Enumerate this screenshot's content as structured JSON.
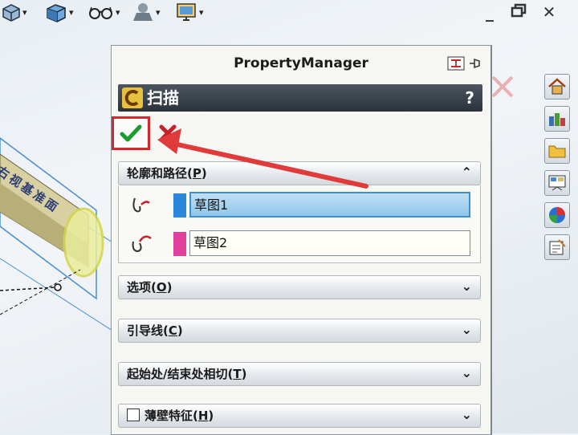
{
  "panel": {
    "title": "PropertyManager",
    "feature_name": "扫描",
    "help_label": "?"
  },
  "viewport": {
    "plane_label": "右视基准面"
  },
  "groups": {
    "profile_path": {
      "label_main": "轮廓和路径(",
      "label_key": "P",
      "label_end": ")",
      "collapse_glyph": "⌃",
      "rows": [
        {
          "value": "草图1",
          "color": "#2a86d8"
        },
        {
          "value": "草图2",
          "color": "#e0409a"
        }
      ]
    },
    "options": {
      "label_main": "选项(",
      "label_key": "O",
      "label_end": ")",
      "expand_glyph": "⌄"
    },
    "guide_curves": {
      "label_main": "引导线(",
      "label_key": "C",
      "label_end": ")",
      "expand_glyph": "⌄"
    },
    "tangency": {
      "label_main": "起始处/结束处相切(",
      "label_key": "T",
      "label_end": ")",
      "expand_glyph": "⌄"
    },
    "thin_feature": {
      "label_main": "薄壁特征(",
      "label_key": "H",
      "label_end": ")",
      "expand_glyph": "⌄"
    }
  },
  "icons": {
    "ok": "green-check-icon",
    "cancel": "red-x-icon",
    "sweep": "sweep-feature-icon"
  },
  "colors": {
    "highlight": "#d8262a",
    "feature_bar": "#2b323a",
    "active_field": "#8fc7ea"
  }
}
